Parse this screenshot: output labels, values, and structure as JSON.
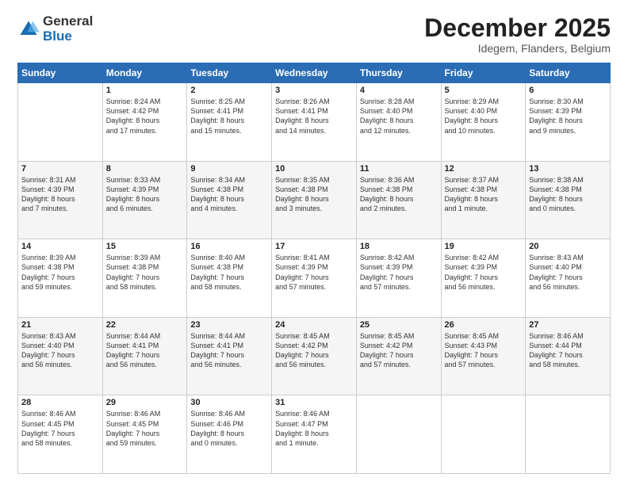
{
  "header": {
    "logo_general": "General",
    "logo_blue": "Blue",
    "month_title": "December 2025",
    "subtitle": "Idegem, Flanders, Belgium"
  },
  "days_of_week": [
    "Sunday",
    "Monday",
    "Tuesday",
    "Wednesday",
    "Thursday",
    "Friday",
    "Saturday"
  ],
  "weeks": [
    [
      {
        "day": "",
        "info": ""
      },
      {
        "day": "1",
        "info": "Sunrise: 8:24 AM\nSunset: 4:42 PM\nDaylight: 8 hours\nand 17 minutes."
      },
      {
        "day": "2",
        "info": "Sunrise: 8:25 AM\nSunset: 4:41 PM\nDaylight: 8 hours\nand 15 minutes."
      },
      {
        "day": "3",
        "info": "Sunrise: 8:26 AM\nSunset: 4:41 PM\nDaylight: 8 hours\nand 14 minutes."
      },
      {
        "day": "4",
        "info": "Sunrise: 8:28 AM\nSunset: 4:40 PM\nDaylight: 8 hours\nand 12 minutes."
      },
      {
        "day": "5",
        "info": "Sunrise: 8:29 AM\nSunset: 4:40 PM\nDaylight: 8 hours\nand 10 minutes."
      },
      {
        "day": "6",
        "info": "Sunrise: 8:30 AM\nSunset: 4:39 PM\nDaylight: 8 hours\nand 9 minutes."
      }
    ],
    [
      {
        "day": "7",
        "info": "Sunrise: 8:31 AM\nSunset: 4:39 PM\nDaylight: 8 hours\nand 7 minutes."
      },
      {
        "day": "8",
        "info": "Sunrise: 8:33 AM\nSunset: 4:39 PM\nDaylight: 8 hours\nand 6 minutes."
      },
      {
        "day": "9",
        "info": "Sunrise: 8:34 AM\nSunset: 4:38 PM\nDaylight: 8 hours\nand 4 minutes."
      },
      {
        "day": "10",
        "info": "Sunrise: 8:35 AM\nSunset: 4:38 PM\nDaylight: 8 hours\nand 3 minutes."
      },
      {
        "day": "11",
        "info": "Sunrise: 8:36 AM\nSunset: 4:38 PM\nDaylight: 8 hours\nand 2 minutes."
      },
      {
        "day": "12",
        "info": "Sunrise: 8:37 AM\nSunset: 4:38 PM\nDaylight: 8 hours\nand 1 minute."
      },
      {
        "day": "13",
        "info": "Sunrise: 8:38 AM\nSunset: 4:38 PM\nDaylight: 8 hours\nand 0 minutes."
      }
    ],
    [
      {
        "day": "14",
        "info": "Sunrise: 8:39 AM\nSunset: 4:38 PM\nDaylight: 7 hours\nand 59 minutes."
      },
      {
        "day": "15",
        "info": "Sunrise: 8:39 AM\nSunset: 4:38 PM\nDaylight: 7 hours\nand 58 minutes."
      },
      {
        "day": "16",
        "info": "Sunrise: 8:40 AM\nSunset: 4:38 PM\nDaylight: 7 hours\nand 58 minutes."
      },
      {
        "day": "17",
        "info": "Sunrise: 8:41 AM\nSunset: 4:39 PM\nDaylight: 7 hours\nand 57 minutes."
      },
      {
        "day": "18",
        "info": "Sunrise: 8:42 AM\nSunset: 4:39 PM\nDaylight: 7 hours\nand 57 minutes."
      },
      {
        "day": "19",
        "info": "Sunrise: 8:42 AM\nSunset: 4:39 PM\nDaylight: 7 hours\nand 56 minutes."
      },
      {
        "day": "20",
        "info": "Sunrise: 8:43 AM\nSunset: 4:40 PM\nDaylight: 7 hours\nand 56 minutes."
      }
    ],
    [
      {
        "day": "21",
        "info": "Sunrise: 8:43 AM\nSunset: 4:40 PM\nDaylight: 7 hours\nand 56 minutes."
      },
      {
        "day": "22",
        "info": "Sunrise: 8:44 AM\nSunset: 4:41 PM\nDaylight: 7 hours\nand 56 minutes."
      },
      {
        "day": "23",
        "info": "Sunrise: 8:44 AM\nSunset: 4:41 PM\nDaylight: 7 hours\nand 56 minutes."
      },
      {
        "day": "24",
        "info": "Sunrise: 8:45 AM\nSunset: 4:42 PM\nDaylight: 7 hours\nand 56 minutes."
      },
      {
        "day": "25",
        "info": "Sunrise: 8:45 AM\nSunset: 4:42 PM\nDaylight: 7 hours\nand 57 minutes."
      },
      {
        "day": "26",
        "info": "Sunrise: 8:45 AM\nSunset: 4:43 PM\nDaylight: 7 hours\nand 57 minutes."
      },
      {
        "day": "27",
        "info": "Sunrise: 8:46 AM\nSunset: 4:44 PM\nDaylight: 7 hours\nand 58 minutes."
      }
    ],
    [
      {
        "day": "28",
        "info": "Sunrise: 8:46 AM\nSunset: 4:45 PM\nDaylight: 7 hours\nand 58 minutes."
      },
      {
        "day": "29",
        "info": "Sunrise: 8:46 AM\nSunset: 4:45 PM\nDaylight: 7 hours\nand 59 minutes."
      },
      {
        "day": "30",
        "info": "Sunrise: 8:46 AM\nSunset: 4:46 PM\nDaylight: 8 hours\nand 0 minutes."
      },
      {
        "day": "31",
        "info": "Sunrise: 8:46 AM\nSunset: 4:47 PM\nDaylight: 8 hours\nand 1 minute."
      },
      {
        "day": "",
        "info": ""
      },
      {
        "day": "",
        "info": ""
      },
      {
        "day": "",
        "info": ""
      }
    ]
  ]
}
